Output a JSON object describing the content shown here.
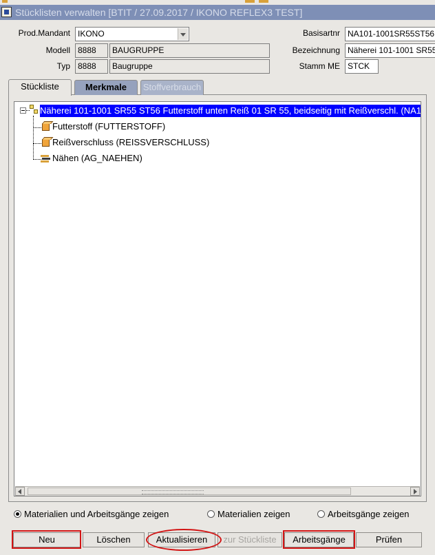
{
  "window": {
    "title": "Stücklisten verwalten   [BTIT / 27.09.2017 / IKONO REFLEX3 TEST]"
  },
  "header": {
    "prod_mandant_label": "Prod.Mandant",
    "prod_mandant_value": "IKONO",
    "modell_label": "Modell",
    "modell_code": "8888",
    "modell_name": "BAUGRUPPE",
    "typ_label": "Typ",
    "typ_code": "8888",
    "typ_name": "Baugruppe",
    "basisartnr_label": "Basisartnr",
    "basisartnr_value": "NA101-1001SR55ST56",
    "bezeichnung_label": "Bezeichnung",
    "bezeichnung_value": "Näherei 101-1001 SR55",
    "stamm_me_label": "Stamm ME",
    "stamm_me_value": "STCK"
  },
  "tabs": [
    {
      "label": "Stückliste",
      "state": "active"
    },
    {
      "label": "Merkmale",
      "state": "inactive"
    },
    {
      "label": "Stoffverbrauch",
      "state": "disabled"
    }
  ],
  "tree": {
    "root": "Näherei 101-1001 SR55 ST56 Futterstoff unten Reiß 01 SR 55, beidseitig mit Reißverschl. (NA1",
    "children": [
      {
        "label": "Futterstoff (FUTTERSTOFF)",
        "icon": "material-cube-icon"
      },
      {
        "label": "Reißverschluss (REISSVERSCHLUSS)",
        "icon": "material-cube-icon"
      },
      {
        "label": "Nähen (AG_NAEHEN)",
        "icon": "operation-icon"
      }
    ]
  },
  "view_options": {
    "selected": "Materialien und Arbeitsgänge zeigen",
    "options": [
      "Materialien und Arbeitsgänge zeigen",
      "Materialien zeigen",
      "Arbeitsgänge zeigen"
    ]
  },
  "buttons": {
    "neu": "Neu",
    "loeschen": "Löschen",
    "aktualisieren": "Aktualisieren",
    "zur_stueckliste": "zur Stückliste",
    "arbeitsgaenge": "Arbeitsgänge",
    "pruefen": "Prüfen"
  },
  "colors": {
    "titlebar": "#7e8fb6",
    "selection": "#0000ff",
    "highlight_annotation": "#d21414",
    "material_icon": "#f0a43a"
  }
}
